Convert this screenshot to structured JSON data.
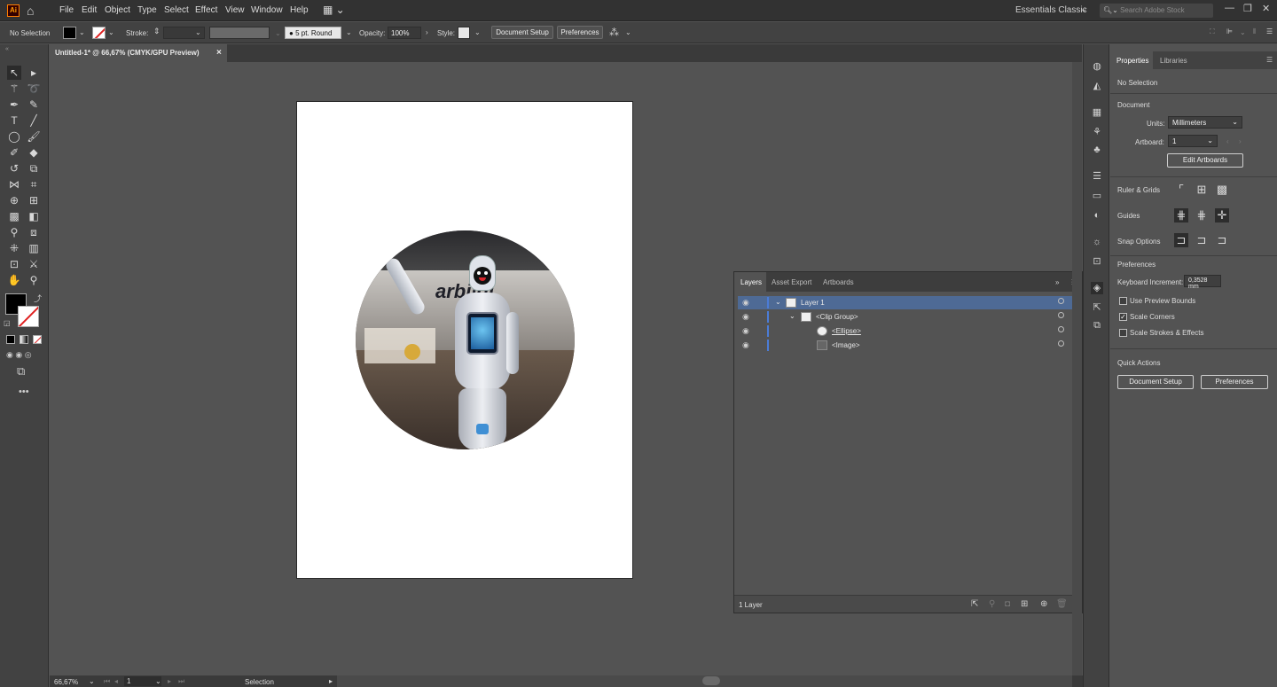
{
  "menubar": {
    "app_logo": "Ai",
    "items": [
      "File",
      "Edit",
      "Object",
      "Type",
      "Select",
      "Effect",
      "View",
      "Window",
      "Help"
    ],
    "workspace": "Essentials Classic",
    "search_placeholder": "Search Adobe Stock"
  },
  "controlbar": {
    "selection": "No Selection",
    "stroke_label": "Stroke:",
    "brush": "5 pt. Round",
    "opacity_label": "Opacity:",
    "opacity_value": "100%",
    "style_label": "Style:",
    "document_setup": "Document Setup",
    "preferences": "Preferences"
  },
  "document": {
    "tab_title": "Untitled-1* @ 66,67% (CMYK/GPU Preview)",
    "close": "×"
  },
  "artwork": {
    "logo_text": "arbilgi"
  },
  "layers_panel": {
    "tabs": [
      "Layers",
      "Asset Export",
      "Artboards"
    ],
    "rows": [
      {
        "name": "Layer 1"
      },
      {
        "name": "<Clip Group>"
      },
      {
        "name": "<Ellipse>"
      },
      {
        "name": "<Image>"
      }
    ],
    "footer_count": "1 Layer"
  },
  "properties_panel": {
    "tabs": [
      "Properties",
      "Libraries"
    ],
    "selection": "No Selection",
    "document_header": "Document",
    "units_label": "Units:",
    "units_value": "Millimeters",
    "artboard_label": "Artboard:",
    "artboard_value": "1",
    "edit_artboards": "Edit Artboards",
    "ruler_grids": "Ruler & Grids",
    "guides": "Guides",
    "snap_options": "Snap Options",
    "preferences_header": "Preferences",
    "keyboard_increment_label": "Keyboard Increment:",
    "keyboard_increment_value": "0,3528 mm",
    "use_preview_bounds": "Use Preview Bounds",
    "scale_corners": "Scale Corners",
    "scale_strokes": "Scale Strokes & Effects",
    "quick_actions": "Quick Actions",
    "document_setup": "Document Setup",
    "preferences_btn": "Preferences",
    "scale_corners_checked": true,
    "use_preview_bounds_checked": false,
    "scale_strokes_checked": false
  },
  "statusbar": {
    "zoom": "66,67%",
    "artboard_num": "1",
    "tool": "Selection"
  },
  "colors": {
    "accent": "#4b7cd6",
    "app_orange": "#ff9a00"
  }
}
